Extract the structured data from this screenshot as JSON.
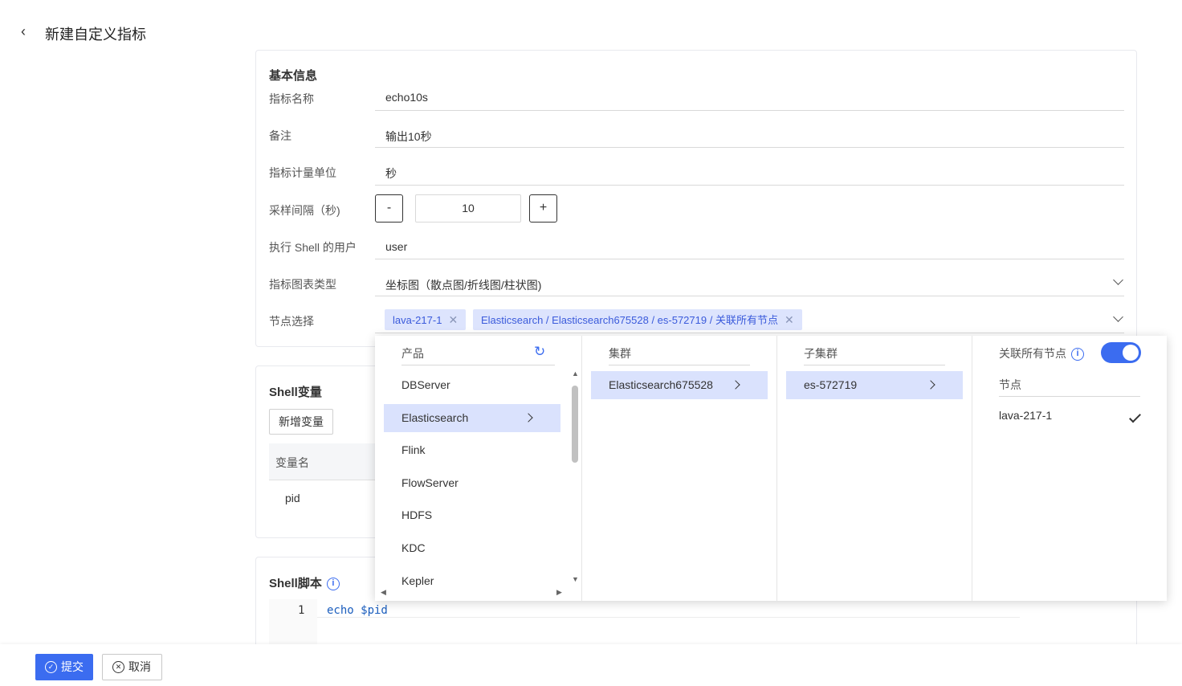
{
  "header": {
    "back_icon": "chevron-left-icon",
    "title": "新建自定义指标"
  },
  "basic": {
    "section_title": "基本信息",
    "fields": {
      "metric_name": {
        "label": "指标名称",
        "value": "echo10s"
      },
      "remark": {
        "label": "备注",
        "value": "输出10秒"
      },
      "unit": {
        "label": "指标计量单位",
        "value": "秒"
      },
      "interval": {
        "label": "采样间隔（秒)",
        "value": "10",
        "minus": "-",
        "plus": "+"
      },
      "shell_user": {
        "label": "执行 Shell 的用户",
        "value": "user"
      },
      "chart_type": {
        "label": "指标图表类型",
        "value": "坐标图（散点图/折线图/柱状图)"
      },
      "nodes": {
        "label": "节点选择",
        "tags": [
          "lava-217-1",
          "Elasticsearch / Elasticsearch675528 / es-572719 / 关联所有节点"
        ]
      }
    }
  },
  "shell_vars": {
    "section_title": "Shell变量",
    "add_button": "新增变量",
    "table": {
      "columns": [
        "变量名"
      ],
      "rows": [
        [
          "pid"
        ]
      ]
    }
  },
  "shell_script": {
    "section_title": "Shell脚本",
    "line_numbers": [
      "1"
    ],
    "code": "echo $pid"
  },
  "cascader": {
    "products": {
      "header": "产品",
      "items": [
        "DBServer",
        "Elasticsearch",
        "Flink",
        "FlowServer",
        "HDFS",
        "KDC",
        "Kepler"
      ],
      "selected": "Elasticsearch"
    },
    "clusters": {
      "header": "集群",
      "items": [
        "Elasticsearch675528"
      ]
    },
    "subclusters": {
      "header": "子集群",
      "items": [
        "es-572719"
      ]
    },
    "nodes": {
      "switch_label": "关联所有节点",
      "switch_on": true,
      "header": "节点",
      "items": [
        "lava-217-1"
      ]
    }
  },
  "footer": {
    "submit": "提交",
    "cancel": "取消"
  },
  "colors": {
    "primary": "#3b6cf0",
    "tag_bg": "#dde4fd",
    "selected_bg": "#dae2fd"
  }
}
